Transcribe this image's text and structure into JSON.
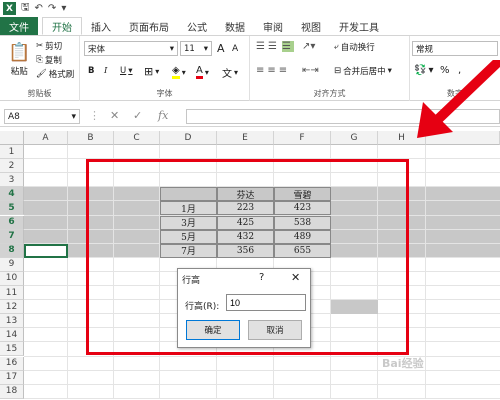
{
  "titlebar": {
    "logo": "X",
    "qa_icons": [
      "save-icon",
      "undo-icon",
      "redo-icon"
    ]
  },
  "tabs": [
    {
      "label": "文件",
      "kind": "file"
    },
    {
      "label": "开始",
      "kind": "active"
    },
    {
      "label": "插入",
      "kind": ""
    },
    {
      "label": "页面布局",
      "kind": ""
    },
    {
      "label": "公式",
      "kind": ""
    },
    {
      "label": "数据",
      "kind": ""
    },
    {
      "label": "审阅",
      "kind": ""
    },
    {
      "label": "视图",
      "kind": ""
    },
    {
      "label": "开发工具",
      "kind": ""
    }
  ],
  "ribbon": {
    "clipboard": {
      "label": "剪贴板",
      "paste": "粘贴",
      "cut": "剪切",
      "copy": "复制",
      "painter": "格式刷"
    },
    "font": {
      "label": "字体",
      "family": "宋体",
      "size": "11",
      "grow": "A",
      "shrink": "A",
      "bold": "B",
      "italic": "I",
      "underline": "U",
      "font_color_letter": "A",
      "pinyin": "文"
    },
    "align": {
      "label": "对齐方式",
      "wrap": "自动换行",
      "merge": "合并后居中"
    },
    "number": {
      "label": "数字",
      "format": "常规",
      "percent": "%",
      "comma": ","
    }
  },
  "formula": {
    "cell_ref": "A8",
    "fx": "fx",
    "value": ""
  },
  "columns": [
    "A",
    "B",
    "C",
    "D",
    "E",
    "F",
    "G",
    "H"
  ],
  "rows": [
    "1",
    "2",
    "3",
    "4",
    "5",
    "6",
    "7",
    "8",
    "9",
    "10",
    "11",
    "12",
    "13",
    "14",
    "15",
    "16",
    "17",
    "18"
  ],
  "selected_rows": [
    "4",
    "5",
    "6",
    "7",
    "8"
  ],
  "table": {
    "headers": [
      "",
      "芬达",
      "雪碧"
    ],
    "rows": [
      [
        "1月",
        "223",
        "423"
      ],
      [
        "3月",
        "425",
        "538"
      ],
      [
        "5月",
        "432",
        "489"
      ],
      [
        "7月",
        "356",
        "655"
      ]
    ]
  },
  "dialog": {
    "title": "行高",
    "help": "?",
    "close": "✕",
    "field_label": "行高(R):",
    "field_value": "10",
    "ok": "确定",
    "cancel": "取消"
  },
  "annotation": {
    "rect_color": "#e60012",
    "arrow_color": "#e60012"
  },
  "colors": {
    "excel_green": "#217346",
    "selection_grey": "#c8c8c8"
  }
}
